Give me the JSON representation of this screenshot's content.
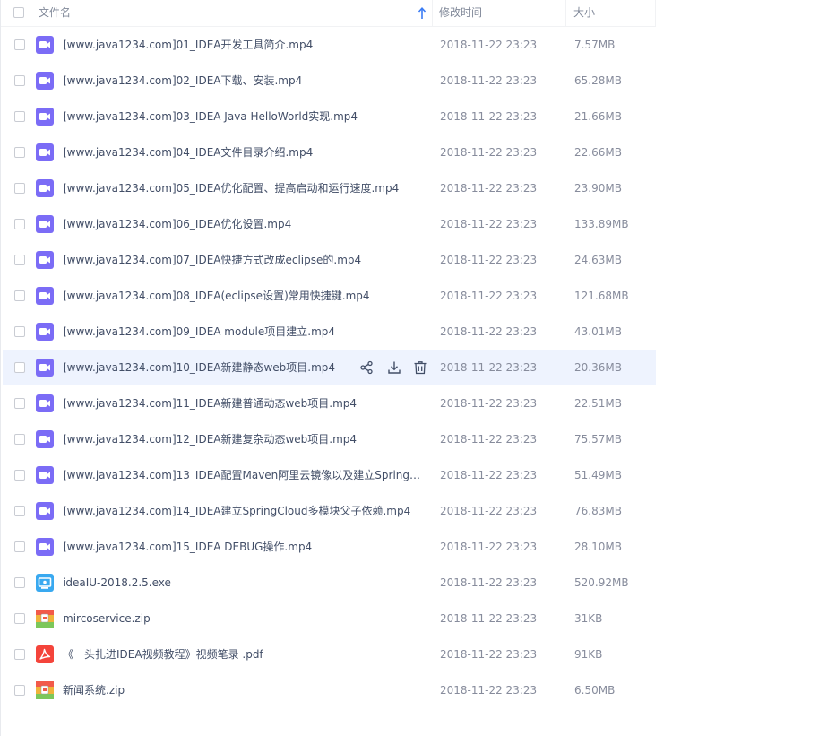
{
  "header": {
    "name_label": "文件名",
    "time_label": "修改时间",
    "size_label": "大小"
  },
  "colors": {
    "video_icon": "#7b6cf6",
    "exe_icon": "#39a9f0",
    "zip_icon": "#f0b33a",
    "pdf_icon": "#f4443b",
    "hover_row": "#eef3fe"
  },
  "files": [
    {
      "name": "[www.java1234.com]01_IDEA开发工具简介.mp4",
      "time": "2018-11-22 23:23",
      "size": "7.57MB",
      "icon": "video-file-icon"
    },
    {
      "name": "[www.java1234.com]02_IDEA下载、安装.mp4",
      "time": "2018-11-22 23:23",
      "size": "65.28MB",
      "icon": "video-file-icon"
    },
    {
      "name": "[www.java1234.com]03_IDEA  Java HelloWorld实现.mp4",
      "time": "2018-11-22 23:23",
      "size": "21.66MB",
      "icon": "video-file-icon"
    },
    {
      "name": "[www.java1234.com]04_IDEA文件目录介绍.mp4",
      "time": "2018-11-22 23:23",
      "size": "22.66MB",
      "icon": "video-file-icon"
    },
    {
      "name": "[www.java1234.com]05_IDEA优化配置、提高启动和运行速度.mp4",
      "time": "2018-11-22 23:23",
      "size": "23.90MB",
      "icon": "video-file-icon"
    },
    {
      "name": "[www.java1234.com]06_IDEA优化设置.mp4",
      "time": "2018-11-22 23:23",
      "size": "133.89MB",
      "icon": "video-file-icon"
    },
    {
      "name": "[www.java1234.com]07_IDEA快捷方式改成eclipse的.mp4",
      "time": "2018-11-22 23:23",
      "size": "24.63MB",
      "icon": "video-file-icon"
    },
    {
      "name": "[www.java1234.com]08_IDEA(eclipse设置)常用快捷键.mp4",
      "time": "2018-11-22 23:23",
      "size": "121.68MB",
      "icon": "video-file-icon"
    },
    {
      "name": "[www.java1234.com]09_IDEA module项目建立.mp4",
      "time": "2018-11-22 23:23",
      "size": "43.01MB",
      "icon": "video-file-icon"
    },
    {
      "name": "[www.java1234.com]10_IDEA新建静态web项目.mp4",
      "time": "2018-11-22 23:23",
      "size": "20.36MB",
      "icon": "video-file-icon"
    },
    {
      "name": "[www.java1234.com]11_IDEA新建普通动态web项目.mp4",
      "time": "2018-11-22 23:23",
      "size": "22.51MB",
      "icon": "video-file-icon"
    },
    {
      "name": "[www.java1234.com]12_IDEA新建复杂动态web项目.mp4",
      "time": "2018-11-22 23:23",
      "size": "75.57MB",
      "icon": "video-file-icon"
    },
    {
      "name": "[www.java1234.com]13_IDEA配置Maven阿里云镜像以及建立SpringBo...",
      "time": "2018-11-22 23:23",
      "size": "51.49MB",
      "icon": "video-file-icon"
    },
    {
      "name": "[www.java1234.com]14_IDEA建立SpringCloud多模块父子依赖.mp4",
      "time": "2018-11-22 23:23",
      "size": "76.83MB",
      "icon": "video-file-icon"
    },
    {
      "name": "[www.java1234.com]15_IDEA DEBUG操作.mp4",
      "time": "2018-11-22 23:23",
      "size": "28.10MB",
      "icon": "video-file-icon"
    },
    {
      "name": "ideaIU-2018.2.5.exe",
      "time": "2018-11-22 23:23",
      "size": "520.92MB",
      "icon": "exe-file-icon"
    },
    {
      "name": "mircoservice.zip",
      "time": "2018-11-22 23:23",
      "size": "31KB",
      "icon": "zip-file-icon"
    },
    {
      "name": "《一头扎进IDEA视频教程》视频笔录 .pdf",
      "time": "2018-11-22 23:23",
      "size": "91KB",
      "icon": "pdf-file-icon"
    },
    {
      "name": "新闻系统.zip",
      "time": "2018-11-22 23:23",
      "size": "6.50MB",
      "icon": "zip-file-icon"
    }
  ]
}
